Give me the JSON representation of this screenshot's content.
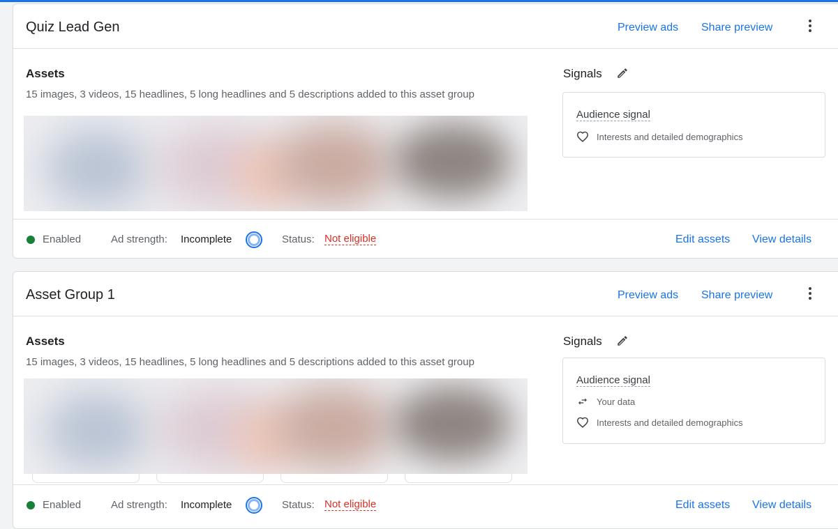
{
  "colors": {
    "accent": "#1a73e8",
    "enabled": "#188038",
    "error": "#d93025",
    "border": "#dadce0"
  },
  "groups": [
    {
      "title": "Quiz Lead Gen",
      "header_links": {
        "preview": "Preview ads",
        "share": "Share preview"
      },
      "menu_icon": "more-vert-icon",
      "assets": {
        "title": "Assets",
        "description": "15 images, 3 videos, 15 headlines, 5 long headlines and 5 descriptions added to this asset group"
      },
      "signals": {
        "title": "Signals",
        "edit_icon": "pencil-icon",
        "audience_title": "Audience signal",
        "items": [
          {
            "icon": "heart-outline-icon",
            "label": "Interests and detailed demographics"
          }
        ]
      },
      "footer": {
        "status_label": "Enabled",
        "strength_label": "Ad strength:",
        "strength_value": "Incomplete",
        "status_prefix": "Status:",
        "status_value": "Not eligible",
        "edit_label": "Edit assets",
        "view_label": "View details"
      }
    },
    {
      "title": "Asset Group 1",
      "header_links": {
        "preview": "Preview ads",
        "share": "Share preview"
      },
      "menu_icon": "more-vert-icon",
      "assets": {
        "title": "Assets",
        "description": "15 images, 3 videos, 15 headlines, 5 long headlines and 5 descriptions added to this asset group"
      },
      "signals": {
        "title": "Signals",
        "edit_icon": "pencil-icon",
        "audience_title": "Audience signal",
        "items": [
          {
            "icon": "swap-arrows-icon",
            "label": "Your data"
          },
          {
            "icon": "heart-outline-icon",
            "label": "Interests and detailed demographics"
          }
        ]
      },
      "footer": {
        "status_label": "Enabled",
        "strength_label": "Ad strength:",
        "strength_value": "Incomplete",
        "status_prefix": "Status:",
        "status_value": "Not eligible",
        "edit_label": "Edit assets",
        "view_label": "View details"
      }
    }
  ]
}
